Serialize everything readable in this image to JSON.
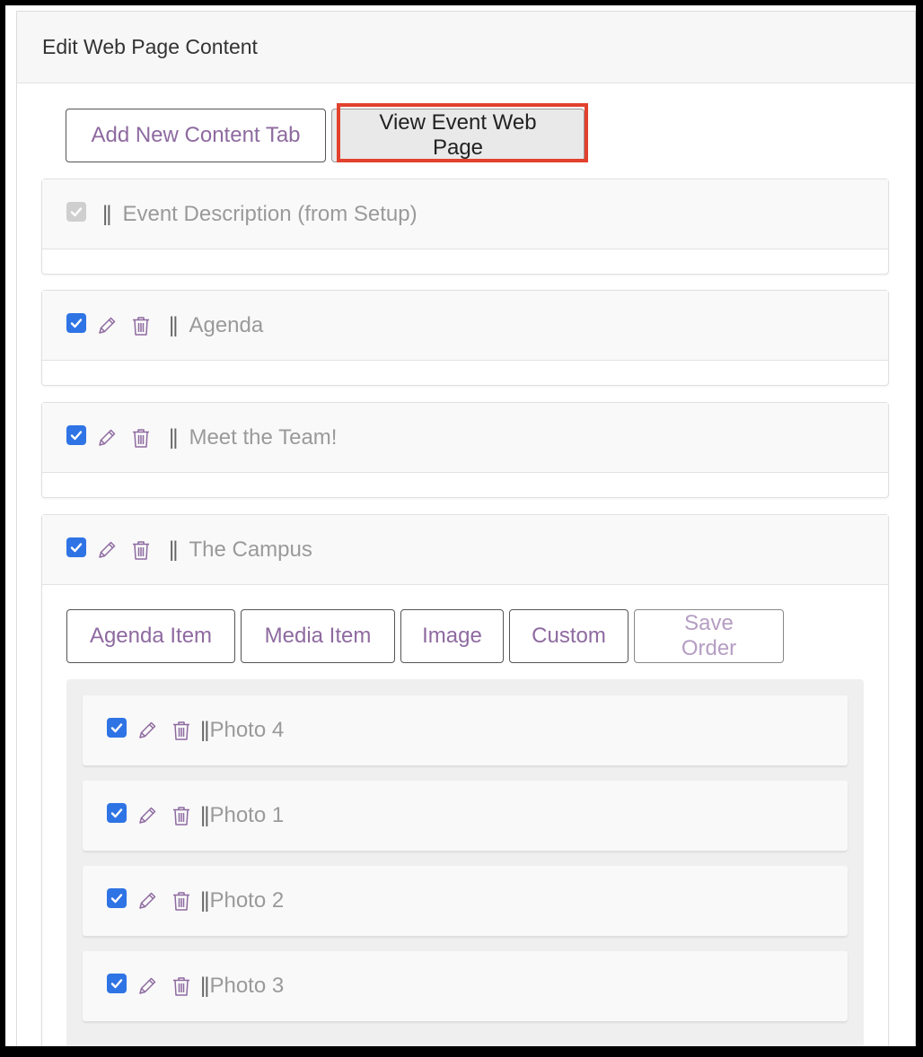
{
  "panel": {
    "title": "Edit Web Page Content"
  },
  "toolbar": {
    "add_tab_label": "Add New Content Tab",
    "view_page_label": "View Event Web Page"
  },
  "grip_glyph": "||",
  "sections": [
    {
      "title": "Event Description (from Setup)",
      "checked": true,
      "disabled": true
    },
    {
      "title": "Agenda",
      "checked": true
    },
    {
      "title": "Meet the Team!",
      "checked": true
    },
    {
      "title": "The Campus",
      "checked": true
    }
  ],
  "campus_buttons": {
    "agenda_item": "Agenda Item",
    "media_item": "Media Item",
    "image": "Image",
    "custom": "Custom",
    "save_order": "Save Order"
  },
  "campus_items": [
    {
      "title": "Photo 4",
      "checked": true
    },
    {
      "title": "Photo 1",
      "checked": true
    },
    {
      "title": "Photo 2",
      "checked": true
    },
    {
      "title": "Photo 3",
      "checked": true
    }
  ],
  "colors": {
    "accent_purple": "#8e6aa0",
    "checkbox_blue": "#2f74e5",
    "highlight_red": "#e2412d"
  }
}
